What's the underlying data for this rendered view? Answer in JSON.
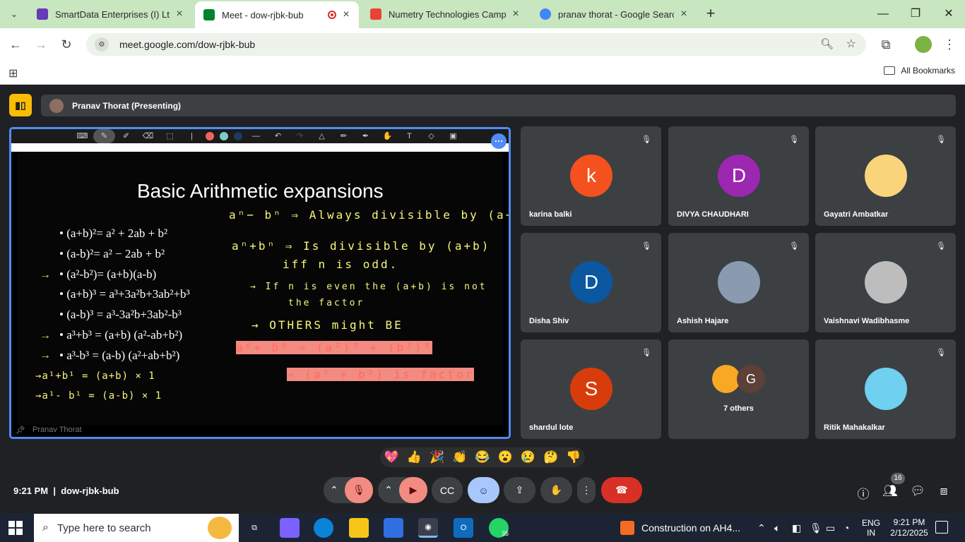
{
  "browser": {
    "tabs": [
      {
        "title": "SmartData Enterprises (I) Ltd. C",
        "favicon_color": "#673ab7",
        "active": false
      },
      {
        "title": "Meet - dow-rjbk-bub",
        "favicon_color": "#00832d",
        "active": true,
        "recording": true
      },
      {
        "title": "Numetry Technologies Campus",
        "favicon_color": "#ea4335",
        "active": false
      },
      {
        "title": "pranav thorat - Google Search",
        "favicon_color": "#4285f4",
        "active": false
      }
    ],
    "url": "meet.google.com/dow-rjbk-bub",
    "bookmarks_label": "All Bookmarks"
  },
  "meet": {
    "presenter_label": "Pranav Thorat (Presenting)",
    "slide": {
      "title": "Basic Arithmetic expansions",
      "bullets": [
        "(a+b)²= a² + 2ab + b²",
        "(a-b)²= a² − 2ab + b²",
        "(a²-b²)= (a+b)(a-b)",
        "(a+b)³ = a³+3a²b+3ab²+b³",
        "(a-b)³ = a³-3a²b+3ab²-b³",
        "a³+b³ = (a+b) (a²-ab+b²)",
        "a³-b³ = (a-b) (a²+ab+b²)"
      ],
      "handwritten_yellow": [
        "aⁿ− bⁿ ⇒ Always divisible by (a−b)",
        "aⁿ+bⁿ ⇒ Is divisible by (a+b)",
        "iff n is odd.",
        "→ If n is even the (a+b) is not",
        "the factor",
        "→ OTHERS might BE",
        "→a¹+b¹ = (a+b) × 1",
        "→a¹- b¹ = (a-b) × 1"
      ],
      "handwritten_red": [
        "a⁶+ b⁶ ⇒ (a²)³ + (b²)³",
        "⇒ (a² + b²)     is factor"
      ]
    },
    "screen_owner": "Pranav Thorat",
    "participants": [
      {
        "name": "karina balki",
        "initial": "k",
        "color": "#f4511e"
      },
      {
        "name": "DIVYA CHAUDHARI",
        "initial": "D",
        "color": "#9c27b0"
      },
      {
        "name": "Gayatri Ambatkar",
        "initial": "",
        "color": "#f9d47a"
      },
      {
        "name": "Disha Shiv",
        "initial": "D",
        "color": "#0b57a0"
      },
      {
        "name": "Ashish Hajare",
        "initial": "",
        "color": "#8a9bb0"
      },
      {
        "name": "Vaishnavi Wadibhasme",
        "initial": "",
        "color": "#bdbdbd"
      },
      {
        "name": "shardul lote",
        "initial": "S",
        "color": "#d93c0b"
      },
      {
        "name": "Ritik Mahakalkar",
        "initial": "",
        "color": "#6fd0f0"
      }
    ],
    "others_label": "7 others",
    "others_initial": "G",
    "reactions": [
      "💖",
      "👍",
      "🎉",
      "👏",
      "😂",
      "😮",
      "😢",
      "🤔",
      "👎"
    ],
    "time": "9:21 PM",
    "meeting_code": "dow-rjbk-bub",
    "people_count": "16"
  },
  "taskbar": {
    "search_placeholder": "Type here to search",
    "news": "Construction on AH4...",
    "lang": [
      "ENG",
      "IN"
    ],
    "time": "9:21 PM",
    "date": "2/12/2025",
    "whatsapp_badge": "35"
  }
}
